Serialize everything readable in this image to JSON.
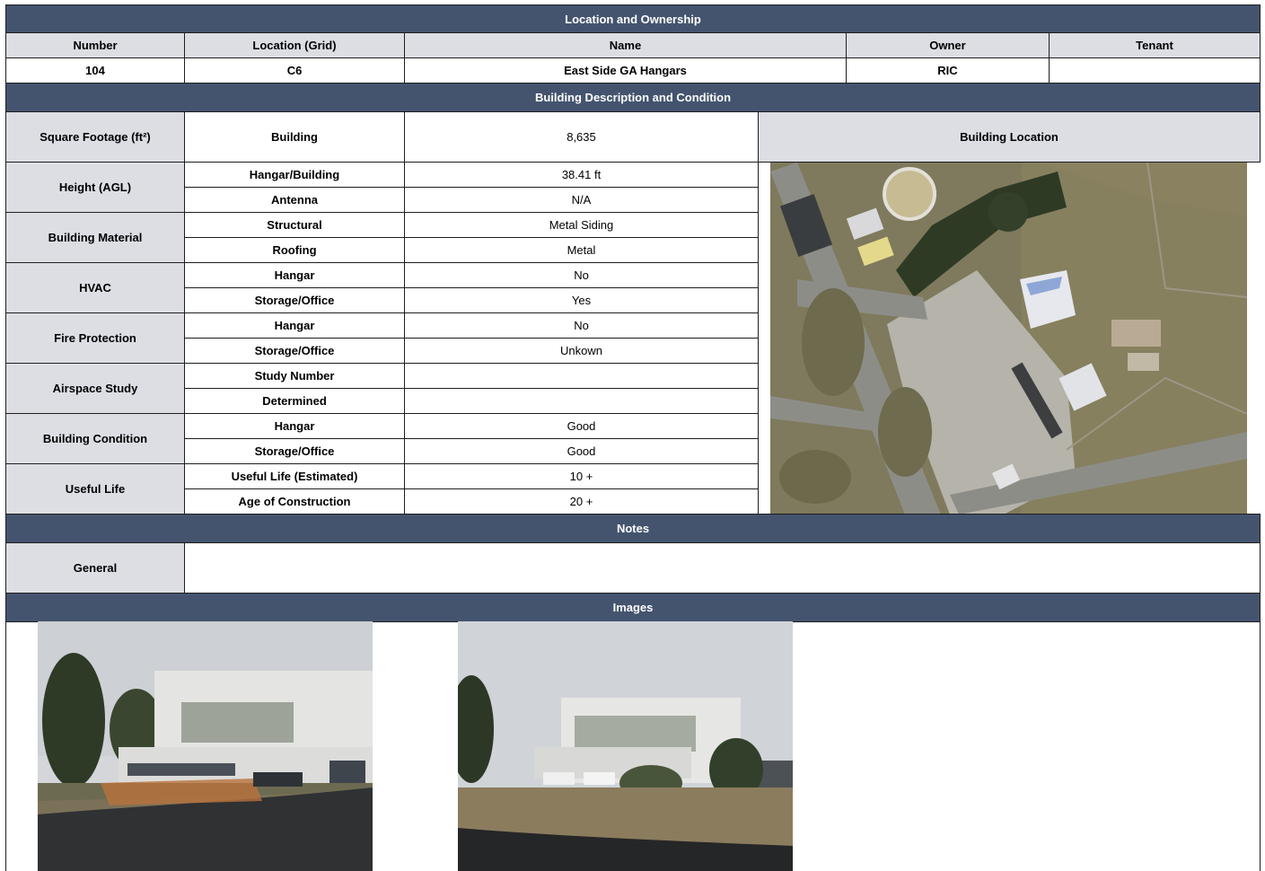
{
  "sections": {
    "location_ownership": "Location and Ownership",
    "building_description": "Building Description and Condition",
    "notes": "Notes",
    "images": "Images"
  },
  "ownership": {
    "headers": [
      "Number",
      "Location (Grid)",
      "Name",
      "Owner",
      "Tenant"
    ],
    "values": [
      "104",
      "C6",
      "East Side GA Hangars",
      "RIC",
      ""
    ]
  },
  "description": {
    "square_footage": {
      "label": "Square Footage (ft²)",
      "sub": "Building",
      "value": "8,635"
    },
    "building_location_label": "Building Location",
    "groups": [
      {
        "label": "Height (AGL)",
        "rows": [
          {
            "sub": "Hangar/Building",
            "value": "38.41 ft"
          },
          {
            "sub": "Antenna",
            "value": "N/A"
          }
        ]
      },
      {
        "label": "Building Material",
        "rows": [
          {
            "sub": "Structural",
            "value": "Metal Siding"
          },
          {
            "sub": "Roofing",
            "value": "Metal"
          }
        ]
      },
      {
        "label": "HVAC",
        "rows": [
          {
            "sub": "Hangar",
            "value": "No"
          },
          {
            "sub": "Storage/Office",
            "value": "Yes"
          }
        ]
      },
      {
        "label": "Fire Protection",
        "rows": [
          {
            "sub": "Hangar",
            "value": "No"
          },
          {
            "sub": "Storage/Office",
            "value": "Unkown"
          }
        ]
      },
      {
        "label": "Airspace Study",
        "rows": [
          {
            "sub": "Study Number",
            "value": ""
          },
          {
            "sub": "Determined",
            "value": ""
          }
        ]
      },
      {
        "label": "Building Condition",
        "rows": [
          {
            "sub": "Hangar",
            "value": "Good"
          },
          {
            "sub": "Storage/Office",
            "value": "Good"
          }
        ]
      },
      {
        "label": "Useful Life",
        "rows": [
          {
            "sub": "Useful Life (Estimated)",
            "value": "10 +"
          },
          {
            "sub": "Age of Construction",
            "value": "20 +"
          }
        ]
      }
    ]
  },
  "notes": {
    "label": "General",
    "value": ""
  },
  "colors": {
    "header_band": "#44546f",
    "label_gray": "#dcdee4",
    "border": "#1e1e1e"
  }
}
